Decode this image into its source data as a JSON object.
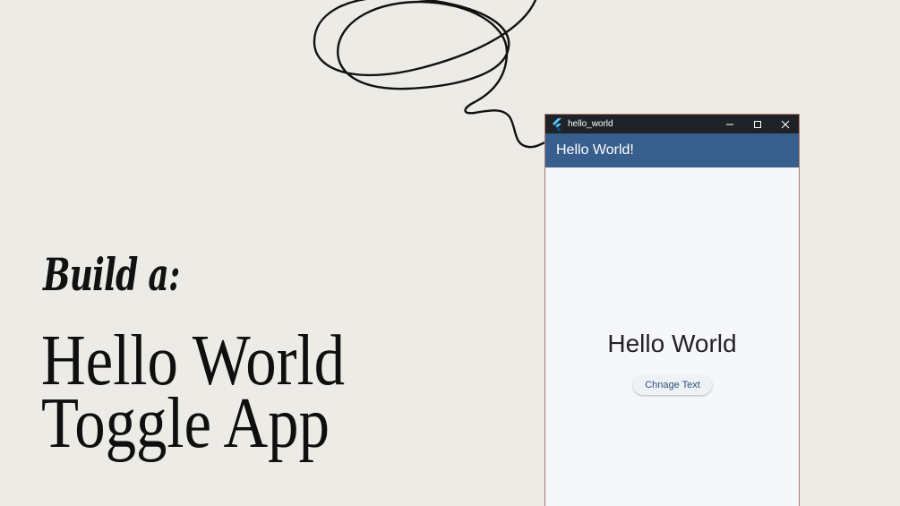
{
  "slide": {
    "subtitle": "Build a:",
    "headline_line1": "Hello World",
    "headline_line2": "Toggle App"
  },
  "window": {
    "title": "hello_world",
    "app_icon": "flutter-icon",
    "controls": [
      "minimize-icon",
      "maximize-icon",
      "close-icon"
    ]
  },
  "app": {
    "appbar_title": "Hello World!",
    "display_text": "Hello World",
    "button_label": "Chnage Text"
  },
  "colors": {
    "background": "#ecebe6",
    "titlebar": "#1f2227",
    "appbar": "#375e8d",
    "app_body": "#f6f7fb",
    "button_text": "#2f4f75"
  }
}
